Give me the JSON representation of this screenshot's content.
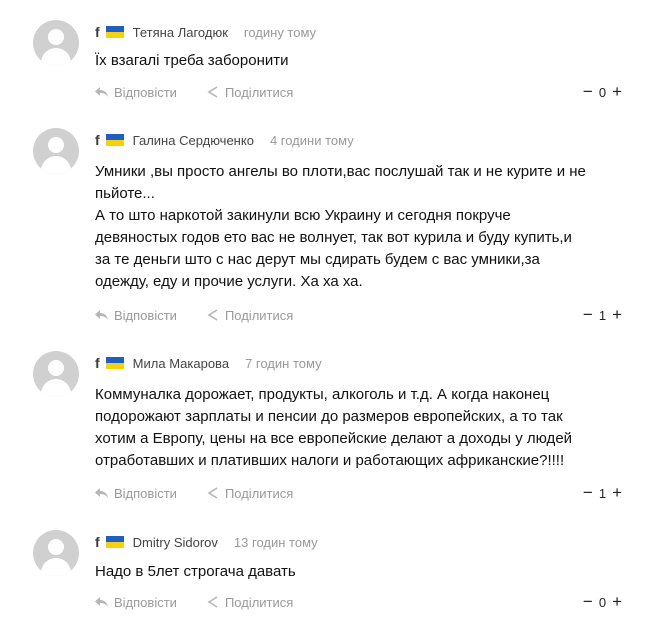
{
  "comments": [
    {
      "fb": "f",
      "author": "Тетяна Лагодюк",
      "time": "годину тому",
      "lines": [
        "Їх взагалі треба заборонити"
      ],
      "reply": "Відповісти",
      "share": "Поділитися",
      "minus": "−",
      "score": "0",
      "plus": "+"
    },
    {
      "fb": "f",
      "author": "Галина Сердюченко",
      "time": "4 години тому",
      "lines": [
        "Умники ,вы просто ангелы во плоти,вас послушай так и не курите и не",
        "пьйоте...",
        "А то што наркотой закинули всю Украину и сегодня покруче",
        "девяностых годов ето вас не волнует, так вот курила и буду купить,и",
        "за те деньги што с нас дерут мы сдирать будем с вас умники,за",
        "одежду, еду и прочие услуги. Ха ха ха."
      ],
      "reply": "Відповісти",
      "share": "Поділитися",
      "minus": "−",
      "score": "1",
      "plus": "+"
    },
    {
      "fb": "f",
      "author": "Мила Макарова",
      "time": "7 годин тому",
      "lines": [
        "Коммуналка дорожает, продукты, алкоголь и т.д. А когда наконец",
        "подорожают зарплаты и пенсии до размеров европейских, а то так",
        "хотим а Европу,  цены на все европейские делают а доходы у людей",
        "отработавших и плативших налоги и работающих африканские?!!!!"
      ],
      "reply": "Відповісти",
      "share": "Поділитися",
      "minus": "−",
      "score": "1",
      "plus": "+"
    },
    {
      "fb": "f",
      "author": "Dmitry Sidorov",
      "time": "13 годин тому",
      "lines": [
        "Надо в 5лет строгача давать"
      ],
      "reply": "Відповісти",
      "share": "Поділитися",
      "minus": "−",
      "score": "0",
      "plus": "+"
    }
  ],
  "icons": {
    "avatar": "default-user-avatar",
    "flag": "ukraine-flag",
    "reply": "reply-arrow-icon",
    "share": "share-icon"
  },
  "colors": {
    "flag_blue": "#1f5fbf",
    "flag_yellow": "#f5d10f",
    "muted_text": "#9a9a9a",
    "avatar_gray": "#d0d0d0"
  }
}
